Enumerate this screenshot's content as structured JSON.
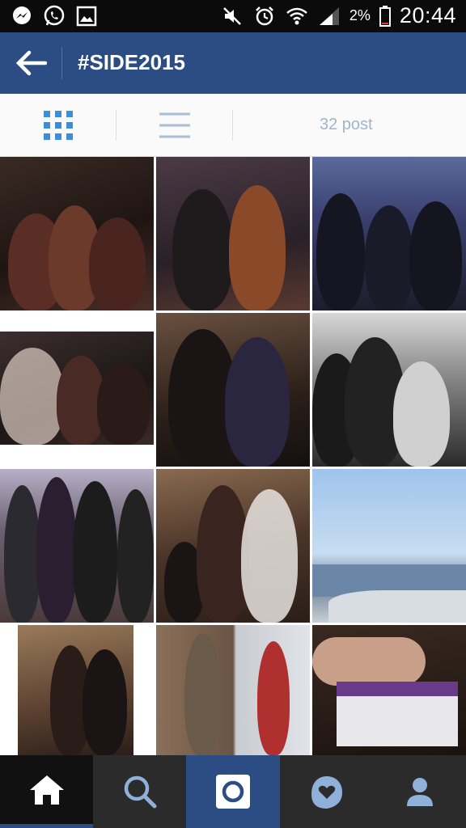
{
  "status_bar": {
    "icons_left": [
      "messenger-icon",
      "whatsapp-icon",
      "gallery-icon"
    ],
    "icons_right": [
      "mute-icon",
      "alarm-icon",
      "wifi-icon",
      "signal-icon",
      "battery-icon"
    ],
    "battery_percent": "2%",
    "time": "20:44"
  },
  "header": {
    "back_icon": "back-arrow-icon",
    "title": "#SIDE2015"
  },
  "view_toggle": {
    "grid_icon": "grid-view-icon",
    "list_icon": "list-view-icon",
    "post_count": "32 post",
    "active": "grid"
  },
  "photos": [
    {
      "scene": "party-group-women"
    },
    {
      "scene": "two-women-party"
    },
    {
      "scene": "three-men-suits"
    },
    {
      "scene": "group-selfie-women"
    },
    {
      "scene": "couple-portrait"
    },
    {
      "scene": "selfie-group-suits"
    },
    {
      "scene": "men-in-suits-hall"
    },
    {
      "scene": "women-stone-wall"
    },
    {
      "scene": "sea-coast-view"
    },
    {
      "scene": "women-stone-wall-2"
    },
    {
      "scene": "collage-two-women"
    },
    {
      "scene": "hello-name-badge"
    }
  ],
  "bottom_nav": {
    "items": [
      "home-icon",
      "search-icon",
      "camera-icon",
      "activity-icon",
      "profile-icon"
    ],
    "active": "home",
    "accent": "#2c4d83"
  },
  "colors": {
    "appbar": "#2c4d83",
    "status_bar": "#0b0b0b",
    "post_count_text": "#9fb4cf",
    "grid_icon": "#3a8fd8"
  }
}
